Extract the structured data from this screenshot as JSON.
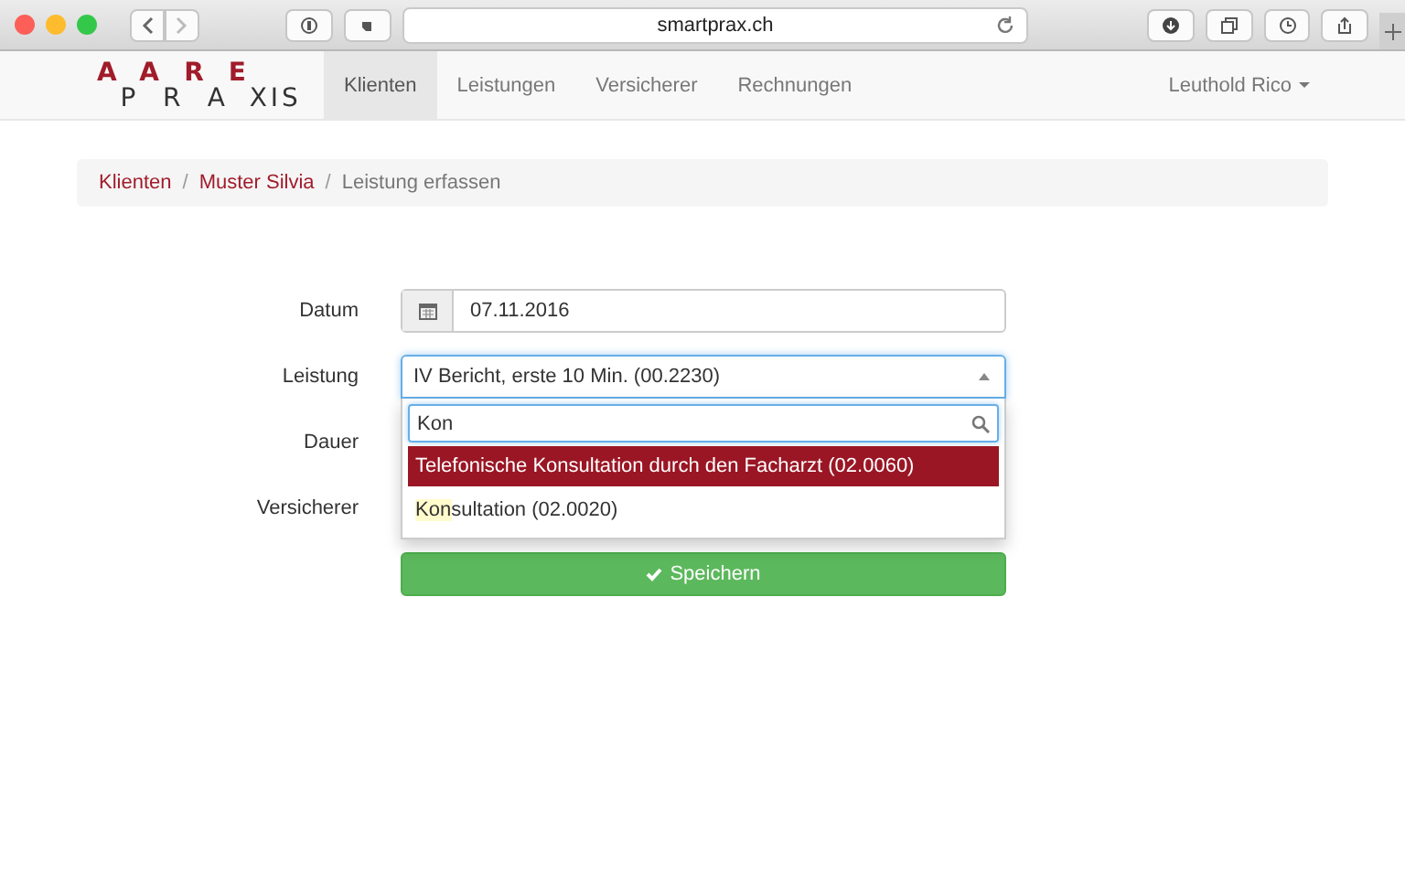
{
  "browser": {
    "url": "smartprax.ch"
  },
  "navbar": {
    "logo": [
      {
        "text": "A",
        "accent": true
      },
      {
        "text": "P",
        "accent": false
      },
      {
        "text": "A",
        "accent": true
      },
      {
        "text": "R",
        "accent": false
      },
      {
        "text": "R",
        "accent": true
      },
      {
        "text": "A",
        "accent": false
      },
      {
        "text": "E",
        "accent": true
      },
      {
        "text": "X",
        "accent": false
      },
      {
        "text": "I",
        "accent": false
      },
      {
        "text": "S",
        "accent": false
      }
    ],
    "items": [
      {
        "label": "Klienten",
        "selected": true
      },
      {
        "label": "Leistungen",
        "selected": false
      },
      {
        "label": "Versicherer",
        "selected": false
      },
      {
        "label": "Rechnungen",
        "selected": false
      }
    ],
    "user": "Leuthold Rico"
  },
  "breadcrumb": [
    {
      "label": "Klienten",
      "current": false
    },
    {
      "separator": "/",
      "label": "Muster Silvia",
      "current": false
    },
    {
      "separator": "/",
      "label": "Leistung erfassen",
      "current": true
    }
  ],
  "form": {
    "datum": {
      "label": "Datum",
      "value": "07.11.2016"
    },
    "leistung": {
      "label": "Leistung",
      "value": "IV Bericht, erste 10 Min. (00.2230)",
      "search": "Kon",
      "options": [
        {
          "parts": [
            {
              "text": "Telefonische Konsultation durch den Facharzt (02.0060)",
              "highlighted": false
            }
          ],
          "selected": true
        },
        {
          "parts": [
            {
              "text": "Kon",
              "highlighted": true
            },
            {
              "text": "sultation (02.0020)",
              "highlighted": false
            }
          ],
          "selected": false
        }
      ]
    },
    "other_labels": [
      "Dauer",
      "Versicherer"
    ],
    "submit": "Speichern"
  }
}
